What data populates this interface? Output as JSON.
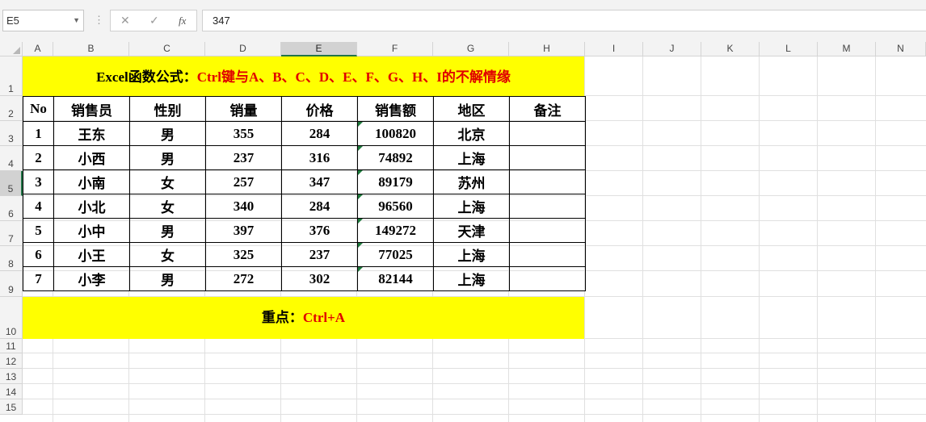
{
  "formula_bar": {
    "name_box": "E5",
    "formula": "347",
    "fx_label": "fx"
  },
  "columns": [
    "A",
    "B",
    "C",
    "D",
    "E",
    "F",
    "G",
    "H",
    "I",
    "J",
    "K",
    "L",
    "M",
    "N"
  ],
  "rows": [
    "1",
    "2",
    "3",
    "4",
    "5",
    "6",
    "7",
    "8",
    "9",
    "10",
    "11",
    "12",
    "13",
    "14",
    "15"
  ],
  "sheet": {
    "title_black": "Excel函数公式：",
    "title_red": "Ctrl键与A、B、C、D、E、F、G、H、I的不解情缘",
    "headers": [
      "No",
      "销售员",
      "性别",
      "销量",
      "价格",
      "销售额",
      "地区",
      "备注"
    ],
    "data": [
      [
        "1",
        "王东",
        "男",
        "355",
        "284",
        "100820",
        "北京",
        ""
      ],
      [
        "2",
        "小西",
        "男",
        "237",
        "316",
        "74892",
        "上海",
        ""
      ],
      [
        "3",
        "小南",
        "女",
        "257",
        "347",
        "89179",
        "苏州",
        ""
      ],
      [
        "4",
        "小北",
        "女",
        "340",
        "284",
        "96560",
        "上海",
        ""
      ],
      [
        "5",
        "小中",
        "男",
        "397",
        "376",
        "149272",
        "天津",
        ""
      ],
      [
        "6",
        "小王",
        "女",
        "325",
        "237",
        "77025",
        "上海",
        ""
      ],
      [
        "7",
        "小李",
        "男",
        "272",
        "302",
        "82144",
        "上海",
        ""
      ]
    ],
    "footer_black": "重点：",
    "footer_red": "Ctrl+A"
  },
  "colors": {
    "highlight": "#ffff00",
    "accent_red": "#e00000",
    "excel_green": "#217346"
  }
}
